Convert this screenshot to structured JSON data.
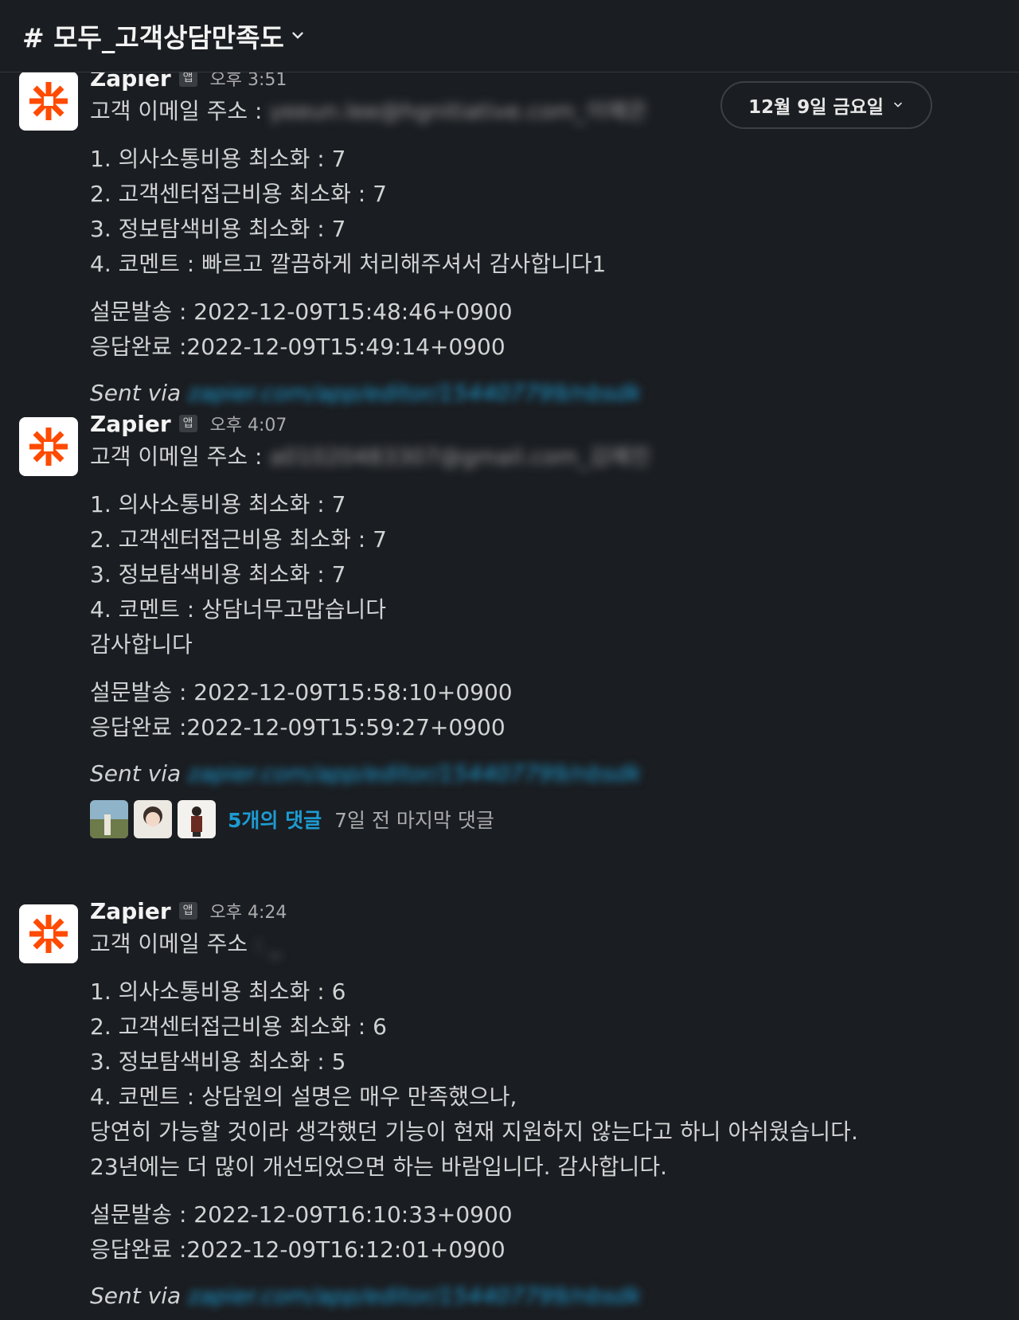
{
  "channel": {
    "name": "# 모두_고객상담만족도",
    "chevron_icon": "chevron-down-icon"
  },
  "date_divider": {
    "label": "12월 9일 금요일"
  },
  "messages": [
    {
      "sender": "Zapier",
      "badge": "앱",
      "time": "오후 3:51",
      "email_label": "고객 이메일 주소 :",
      "email_value": "yeeun.lee@hgnitiative.com_이예은",
      "lines": [
        "1. 의사소통비용 최소화 : 7",
        "2. 고객센터접근비용 최소화 : 7",
        "3. 정보탐색비용 최소화 : 7",
        "4. 코멘트 :  빠르고 깔끔하게 처리해주셔서 감사합니다1"
      ],
      "sent_at": "설문발송 : 2022-12-09T15:48:46+0900",
      "done_at": "응답완료 :2022-12-09T15:49:14+0900",
      "sent_via": "Sent via",
      "link": "zapier.com/app/editor/154407799/nbsdk"
    },
    {
      "sender": "Zapier",
      "badge": "앱",
      "time": "오후 4:07",
      "email_label": "고객 이메일 주소 :",
      "email_value": "a01020483307@gmail.com_김예진",
      "lines": [
        "1. 의사소통비용 최소화 : 7",
        "2. 고객센터접근비용 최소화 : 7",
        "3. 정보탐색비용 최소화 : 7",
        "4. 코멘트 :  상담너무고맙습니다",
        "감사합니다"
      ],
      "sent_at": "설문발송 : 2022-12-09T15:58:10+0900",
      "done_at": "응답완료 :2022-12-09T15:59:27+0900",
      "sent_via": "Sent via",
      "link": "zapier.com/app/editor/154407799/nbsdk",
      "thread": {
        "replies": "5개의 댓글",
        "last_reply": "7일 전 마지막 댓글"
      }
    },
    {
      "sender": "Zapier",
      "badge": "앱",
      "time": "오후 4:24",
      "email_label": "고객 이메일 주소",
      "email_value": ": _",
      "lines": [
        "1. 의사소통비용 최소화 : 6",
        "2. 고객센터접근비용 최소화 : 6",
        "3. 정보탐색비용 최소화 : 5",
        "4. 코멘트 :  상담원의 설명은 매우 만족했으나,",
        "당연히 가능할 것이라 생각했던 기능이 현재 지원하지 않는다고 하니 아쉬웠습니다.",
        "23년에는 더 많이 개선되었으면 하는 바람입니다. 감사합니다."
      ],
      "sent_at": "설문발송 : 2022-12-09T16:10:33+0900",
      "done_at": "응답완료 :2022-12-09T16:12:01+0900",
      "sent_via": "Sent via",
      "link": "zapier.com/app/editor/154407799/nbsdk"
    }
  ],
  "colors": {
    "background": "#1a1d21",
    "text": "#d1d2d3",
    "link": "#1d9bd1",
    "zapier_orange": "#ff4a00"
  }
}
